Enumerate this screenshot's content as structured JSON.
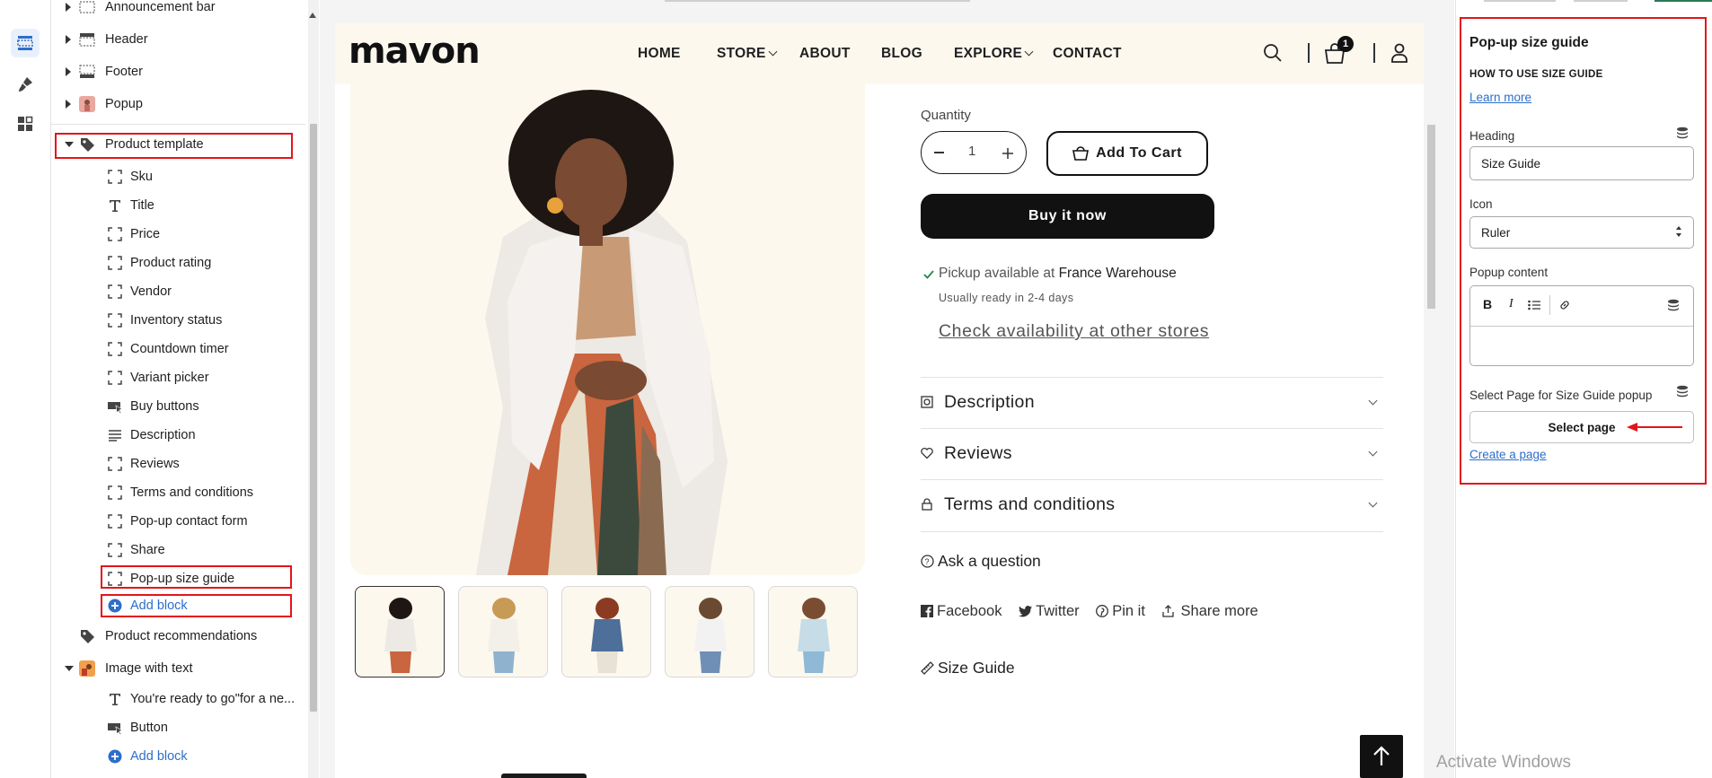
{
  "sidebar_tree": {
    "cut_item": "Announcement bar",
    "sections": [
      {
        "label": "Header",
        "icon": "header-section-icon"
      },
      {
        "label": "Footer",
        "icon": "footer-section-icon"
      },
      {
        "label": "Popup",
        "icon": "popup-thumbnail-icon"
      }
    ],
    "product_template": {
      "label": "Product template",
      "blocks": [
        {
          "label": "Sku",
          "icon": "block-frame-icon"
        },
        {
          "label": "Title",
          "icon": "text-t-icon"
        },
        {
          "label": "Price",
          "icon": "block-frame-icon"
        },
        {
          "label": "Product rating",
          "icon": "block-frame-icon"
        },
        {
          "label": "Vendor",
          "icon": "block-frame-icon"
        },
        {
          "label": "Inventory status",
          "icon": "block-frame-icon"
        },
        {
          "label": "Countdown timer",
          "icon": "block-frame-icon"
        },
        {
          "label": "Variant picker",
          "icon": "block-frame-icon"
        },
        {
          "label": "Buy buttons",
          "icon": "buy-buttons-icon"
        },
        {
          "label": "Description",
          "icon": "paragraph-icon"
        },
        {
          "label": "Reviews",
          "icon": "block-frame-icon"
        },
        {
          "label": "Terms and conditions",
          "icon": "block-frame-icon"
        },
        {
          "label": "Pop-up contact form",
          "icon": "block-frame-icon"
        },
        {
          "label": "Share",
          "icon": "block-frame-icon"
        },
        {
          "label": "Pop-up size guide",
          "icon": "block-frame-icon"
        }
      ],
      "add_block": "Add block"
    },
    "product_recommendations": "Product recommendations",
    "image_with_text": {
      "label": "Image with text",
      "blocks": [
        {
          "label": "You're ready to go\"for a ne...",
          "icon": "text-t-icon"
        },
        {
          "label": "Button",
          "icon": "buy-buttons-icon"
        }
      ],
      "add_block": "Add block"
    }
  },
  "store": {
    "logo": "mavon",
    "nav": [
      "HOME",
      "STORE",
      "ABOUT",
      "BLOG",
      "EXPLORE",
      "CONTACT"
    ],
    "cart_count": "1",
    "quantity_label": "Quantity",
    "quantity_value": "1",
    "add_to_cart": "Add To Cart",
    "buy_now": "Buy it now",
    "pickup_prefix": "Pickup available at",
    "pickup_location": "France Warehouse",
    "ready_text": "Usually ready in 2-4 days",
    "check_link": "Check availability at other stores",
    "accordions": [
      "Description",
      "Reviews",
      "Terms and conditions"
    ],
    "ask_question": "Ask a question",
    "share": [
      "Facebook",
      "Twitter",
      "Pin it",
      "Share more"
    ],
    "size_guide": "Size Guide",
    "accent": "#fcf8ee"
  },
  "settings": {
    "title": "Pop-up size guide",
    "subtitle": "HOW TO USE SIZE GUIDE",
    "learn_more": "Learn more",
    "heading_label": "Heading",
    "heading_value": "Size Guide",
    "icon_label": "Icon",
    "icon_value": "Ruler",
    "popup_content_label": "Popup content",
    "select_page_label": "Select Page for Size Guide popup",
    "select_page_button": "Select page",
    "create_page": "Create a page"
  },
  "watermark": "Activate Windows",
  "colors": {
    "highlight": "#e3151a",
    "link": "#2c6ecb",
    "dark": "#111111"
  }
}
